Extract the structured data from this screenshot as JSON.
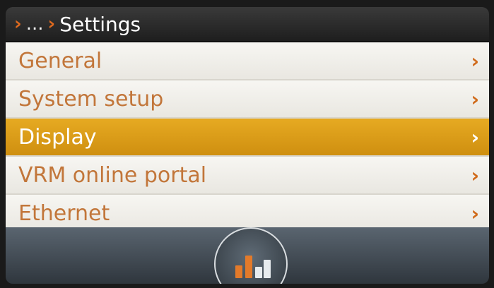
{
  "header": {
    "breadcrumb_ellipsis": "...",
    "title": "Settings",
    "chevron_icon": "chevron-right-icon"
  },
  "menu": {
    "items": [
      {
        "label": "General",
        "selected": false
      },
      {
        "label": "System setup",
        "selected": false
      },
      {
        "label": "Display",
        "selected": true
      },
      {
        "label": "VRM online portal",
        "selected": false
      },
      {
        "label": "Ethernet",
        "selected": false
      }
    ],
    "arrow_glyph": "›"
  },
  "footer": {
    "home_icon": "overview-chart-icon"
  },
  "colors": {
    "accent": "#e06a1e",
    "selected_bg": "#d89a18",
    "label_text": "#c2763a"
  }
}
